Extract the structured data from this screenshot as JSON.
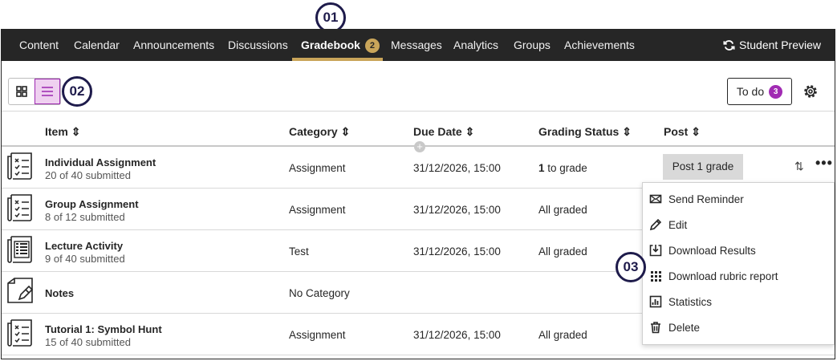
{
  "callouts": [
    "01",
    "02",
    "03"
  ],
  "nav": {
    "items": [
      "Content",
      "Calendar",
      "Announcements",
      "Discussions",
      "Gradebook",
      "Messages",
      "Analytics",
      "Groups",
      "Achievements"
    ],
    "gradebook_badge": "2",
    "student_preview": "Student Preview",
    "active": "Gradebook"
  },
  "toolbar": {
    "todo_label": "To do",
    "todo_count": "3"
  },
  "table": {
    "headers": [
      "Item",
      "Category",
      "Due Date",
      "Grading Status",
      "Post"
    ],
    "sort_glyph": "⇕",
    "add_column": "+",
    "rows": [
      {
        "title": "Individual Assignment",
        "sub": "20 of 40 submitted",
        "category": "Assignment",
        "due": "31/12/2026, 15:00",
        "status_num": "1",
        "status_text": " to grade",
        "post": "Post 1 grade",
        "icon": "checklist-icon"
      },
      {
        "title": "Group Assignment",
        "sub": "8 of 12 submitted",
        "category": "Assignment",
        "due": "31/12/2026, 15:00",
        "status_num": "",
        "status_text": "All graded",
        "post": "",
        "icon": "checklist-icon"
      },
      {
        "title": "Lecture Activity",
        "sub": "9 of 40 submitted",
        "category": "Test",
        "due": "31/12/2026, 15:00",
        "status_num": "",
        "status_text": "All graded",
        "post": "",
        "icon": "test-icon"
      },
      {
        "title": "Notes",
        "sub": "",
        "category": "No Category",
        "due": "",
        "status_num": "",
        "status_text": "",
        "post": "",
        "icon": "notes-icon"
      },
      {
        "title": "Tutorial 1: Symbol Hunt",
        "sub": "15 of 40 submitted",
        "category": "Assignment",
        "due": "31/12/2026, 15:00",
        "status_num": "",
        "status_text": "All graded",
        "post": "",
        "icon": "checklist-icon"
      }
    ]
  },
  "menu": {
    "items": [
      {
        "label": "Send Reminder",
        "icon": "envelope-icon"
      },
      {
        "label": "Edit",
        "icon": "pencil-icon"
      },
      {
        "label": "Download Results",
        "icon": "download-icon"
      },
      {
        "label": "Download rubric report",
        "icon": "rubric-icon"
      },
      {
        "label": "Statistics",
        "icon": "statistics-icon"
      },
      {
        "label": "Delete",
        "icon": "trash-icon"
      }
    ]
  },
  "colors": {
    "nav_bg": "#262626",
    "accent_gold": "#c9a55a",
    "accent_purple": "#a12bb3",
    "callout": "#1e1b4b"
  }
}
